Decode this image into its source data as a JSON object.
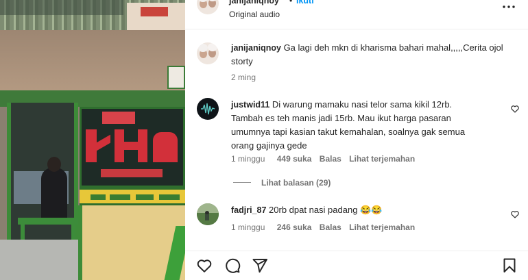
{
  "header": {
    "username": "janijaniqnoy",
    "separator": "•",
    "follow_label": "Ikuti",
    "audio_label": "Original audio",
    "more_icon": "more-horizontal-icon"
  },
  "caption": {
    "username": "janijaniqnoy",
    "text": "Ga lagi deh mkn di kharisma bahari mahal,,,,,Cerita ojol storty",
    "time": "2 ming"
  },
  "comments": [
    {
      "username": "justwid11",
      "text_line1": "Di warung mamaku nasi telor sama kikil 12rb.",
      "text_line2": "Tambah es teh manis jadi 15rb. Mau ikut harga pasaran",
      "text_line3": "umumnya tapi kasian takut kemahalan, soalnya gak semua",
      "text_line4": "orang gajinya gede",
      "time": "1 minggu",
      "likes": "449 suka",
      "reply_label": "Balas",
      "translate_label": "Lihat terjemahan",
      "view_replies": "Lihat balasan (29)"
    },
    {
      "username": "fadjri_87",
      "text": "20rb dpat nasi padang 😂😂",
      "time": "1 minggu",
      "likes": "246 suka",
      "reply_label": "Balas",
      "translate_label": "Lihat terjemahan"
    }
  ],
  "actions": {
    "like_icon": "heart-icon",
    "comment_icon": "comment-icon",
    "share_icon": "share-icon",
    "save_icon": "bookmark-icon"
  },
  "colors": {
    "text": "#262626",
    "muted": "#737373",
    "link": "#0095f6",
    "border": "#efefef"
  }
}
